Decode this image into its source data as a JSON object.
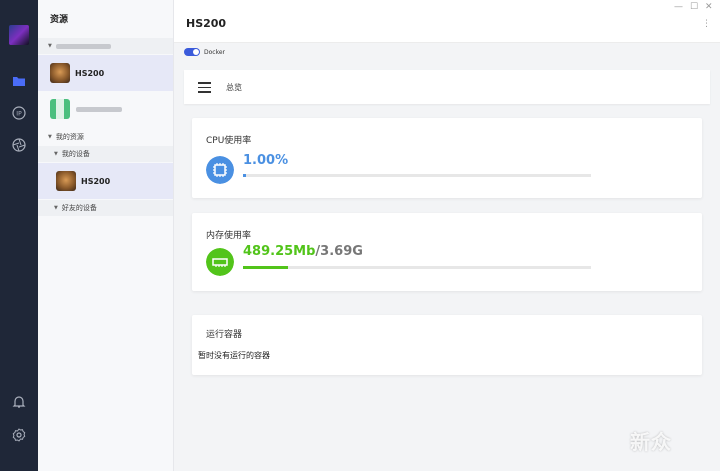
{
  "tree": {
    "title": "资源",
    "my_resources_label": "我的资源",
    "my_devices_label": "我的设备",
    "friend_devices_label": "好友的设备",
    "devices": [
      {
        "label": "HS200"
      },
      {
        "label": ""
      },
      {
        "label": "HS200"
      }
    ]
  },
  "header": {
    "title": "HS200"
  },
  "docker": {
    "label": "Docker",
    "enabled": true
  },
  "overview": {
    "label": "总览"
  },
  "cpu": {
    "title": "CPU使用率",
    "value": "1.00%",
    "percent": 1.0,
    "color": "#4a90e2"
  },
  "memory": {
    "title": "内存使用率",
    "used": "489.25Mb",
    "separator": "/",
    "total": "3.69G",
    "percent": 13.0,
    "color": "#52c41a"
  },
  "containers": {
    "title": "运行容器",
    "empty_text": "暂时没有运行的容器"
  },
  "watermark": {
    "text": "新众"
  },
  "icons": [
    "folder-icon",
    "chip-icon",
    "aperture-icon",
    "bell-icon",
    "settings-icon",
    "minimize-icon",
    "maximize-icon",
    "close-icon",
    "kebab-icon",
    "menu-icon"
  ]
}
